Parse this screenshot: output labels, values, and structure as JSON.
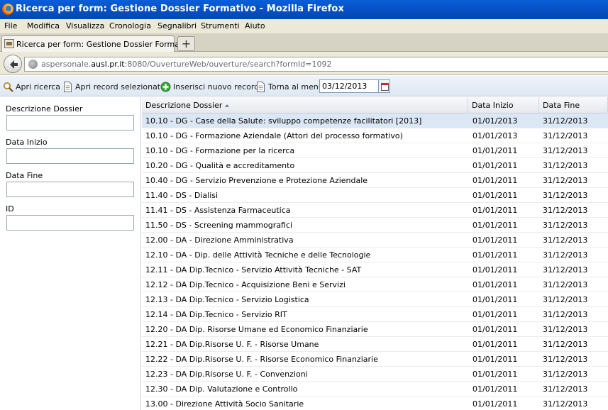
{
  "window": {
    "title": "Ricerca per form: Gestione Dossier Formativo - Mozilla Firefox"
  },
  "menu": {
    "items": [
      "File",
      "Modifica",
      "Visualizza",
      "Cronologia",
      "Segnalibri",
      "Strumenti",
      "Aiuto"
    ]
  },
  "tabs": {
    "active_label": "Ricerca per form: Gestione Dossier Formativo",
    "new_tab_label": "+"
  },
  "nav": {
    "url_prefix": "aspersonale.",
    "url_domain": "ausl.pr.it",
    "url_suffix": ":8080/OuvertureWeb/ouverture/search?formId=1092"
  },
  "toolbar": {
    "open_search": "Apri ricerca",
    "open_selected": "Apri record selezionato",
    "insert_new": "Inserisci nuovo record",
    "back_menu": "Torna al menù",
    "date_value": "03/12/2013"
  },
  "filters": {
    "descrizione_label": "Descrizione Dossier",
    "data_inizio_label": "Data Inizio",
    "data_fine_label": "Data Fine",
    "id_label": "ID"
  },
  "grid": {
    "headers": [
      "Descrizione Dossier",
      "Data Inizio",
      "Data Fine"
    ],
    "rows": [
      [
        "10.10 - DG - Case della Salute: sviluppo competenze facilitatori [2013]",
        "01/01/2013",
        "31/12/2013"
      ],
      [
        "10.10 - DG - Formazione Aziendale (Attori del processo formativo)",
        "01/01/2013",
        "31/12/2013"
      ],
      [
        "10.10 - DG - Formazione per la ricerca",
        "01/01/2011",
        "31/12/2013"
      ],
      [
        "10.20 - DG - Qualità e accreditamento",
        "01/01/2011",
        "31/12/2013"
      ],
      [
        "10.40 - DG - Servizio Prevenzione e Protezione Aziendale",
        "01/01/2011",
        "31/12/2013"
      ],
      [
        "11.40 - DS - Dialisi",
        "01/01/2011",
        "31/12/2013"
      ],
      [
        "11.41 - DS - Assistenza Farmaceutica",
        "01/01/2011",
        "31/12/2013"
      ],
      [
        "11.50 - DS - Screening mammografici",
        "01/01/2011",
        "31/12/2013"
      ],
      [
        "12.00 - DA - Direzione Amministrativa",
        "01/01/2011",
        "31/12/2013"
      ],
      [
        "12.10 - DA - Dip. delle Attività Tecniche e delle Tecnologie",
        "01/01/2011",
        "31/12/2013"
      ],
      [
        "12.11 - DA Dip.Tecnico - Servizio Attività Tecniche - SAT",
        "01/01/2011",
        "31/12/2013"
      ],
      [
        "12.12 - DA Dip.Tecnico - Acquisizione Beni e Servizi",
        "01/01/2011",
        "31/12/2013"
      ],
      [
        "12.13 - DA Dip.Tecnico - Servizio Logistica",
        "01/01/2011",
        "31/12/2013"
      ],
      [
        "12.14 - DA Dip.Tecnico - Servizio RIT",
        "01/01/2011",
        "31/12/2013"
      ],
      [
        "12.20 - DA Dip. Risorse Umane ed Economico Finanziarie",
        "01/01/2011",
        "31/12/2013"
      ],
      [
        "12.21 - DA Dip.Risorse U. F. - Risorse Umane",
        "01/01/2011",
        "31/12/2013"
      ],
      [
        "12.22 - DA Dip.Risorse U. F. - Risorse Economico Finanziarie",
        "01/01/2011",
        "31/12/2013"
      ],
      [
        "12.23 - DA Dip.Risorse U. F. - Convenzioni",
        "01/01/2011",
        "31/12/2013"
      ],
      [
        "12.30 - DA Dip. Valutazione e Controllo",
        "01/01/2011",
        "31/12/2013"
      ],
      [
        "13.00 - Direzione Attività Socio Sanitarie",
        "01/01/2011",
        "31/12/2013"
      ]
    ]
  },
  "colors": {
    "titlebar": "#0750c4",
    "selected_row": "#dce7f5",
    "insert_icon": "#3aa83a"
  }
}
